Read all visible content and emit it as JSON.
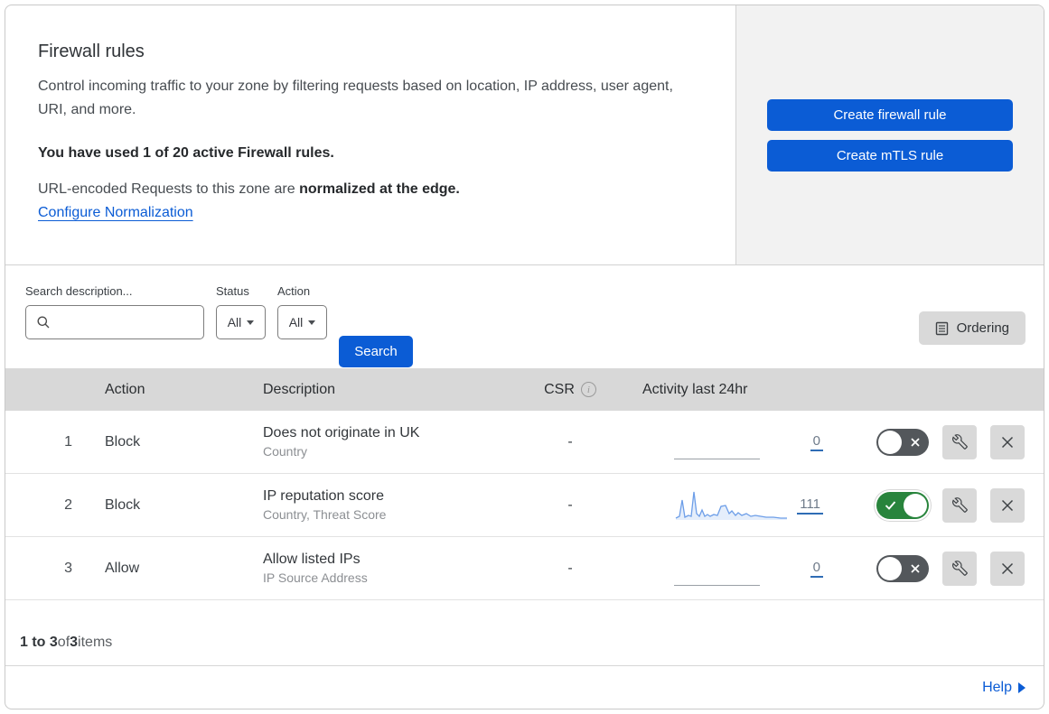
{
  "header": {
    "title": "Firewall rules",
    "description": "Control incoming traffic to your zone by filtering requests based on location, IP address, user agent, URI, and more.",
    "usage_line": "You have used 1 of 20 active Firewall rules.",
    "normalization_prefix": "URL-encoded Requests to this zone are ",
    "normalization_bold": "normalized at the edge.",
    "configure_link": "Configure Normalization",
    "buttons": [
      {
        "label": "Create firewall rule"
      },
      {
        "label": "Create mTLS rule"
      }
    ]
  },
  "filters": {
    "search_label": "Search description...",
    "status_label": "Status",
    "status_value": "All",
    "action_label": "Action",
    "action_value": "All",
    "search_button": "Search",
    "ordering_button": "Ordering"
  },
  "table": {
    "columns": {
      "action": "Action",
      "description": "Description",
      "csr": "CSR",
      "activity": "Activity last 24hr"
    },
    "rows": [
      {
        "num": "1",
        "action": "Block",
        "description": "Does not originate in UK",
        "criteria": "Country",
        "csr": "-",
        "activity_count": "0",
        "enabled": false
      },
      {
        "num": "2",
        "action": "Block",
        "description": "IP reputation score",
        "criteria": "Country, Threat Score",
        "csr": "-",
        "activity_count": "111",
        "enabled": true,
        "sparkline_points": [
          [
            2,
            33
          ],
          [
            6,
            31
          ],
          [
            9,
            13
          ],
          [
            12,
            32
          ],
          [
            16,
            30
          ],
          [
            19,
            31
          ],
          [
            22,
            4
          ],
          [
            25,
            28
          ],
          [
            28,
            31
          ],
          [
            31,
            24
          ],
          [
            34,
            31
          ],
          [
            37,
            29
          ],
          [
            40,
            31
          ],
          [
            44,
            29
          ],
          [
            48,
            30
          ],
          [
            52,
            20
          ],
          [
            57,
            19
          ],
          [
            61,
            28
          ],
          [
            64,
            25
          ],
          [
            68,
            30
          ],
          [
            71,
            27
          ],
          [
            75,
            30
          ],
          [
            80,
            28
          ],
          [
            85,
            31
          ],
          [
            90,
            30
          ],
          [
            96,
            31
          ],
          [
            102,
            32
          ],
          [
            110,
            32
          ],
          [
            118,
            33
          ],
          [
            125,
            33
          ]
        ]
      },
      {
        "num": "3",
        "action": "Allow",
        "description": "Allow listed IPs",
        "criteria": "IP Source Address",
        "csr": "-",
        "activity_count": "0",
        "enabled": false
      }
    ]
  },
  "pagination": {
    "range": "1 to 3",
    "of": " of ",
    "total": "3",
    "items": " items"
  },
  "help": {
    "label": "Help"
  },
  "icons": {
    "search": "magnifier",
    "ordering": "document-list",
    "info": "circle-i",
    "info_glyph": "i",
    "caret": "triangle-down",
    "wrench": "spanner",
    "close": "x-mark",
    "toggle_on_mark": "check-mark",
    "toggle_off_mark": "x-mark",
    "help_arrow": "triangle-right"
  },
  "colors": {
    "accent_blue": "#0b5cd5",
    "link_blue": "#0b5cd5",
    "toggle_on_green": "#28843c",
    "toggle_off_gray": "#53575b",
    "panel_gray": "#f2f2f2",
    "table_header_gray": "#d8d8d8",
    "control_gray": "#d9d9d9",
    "sparkline_blue": "#6d9ee8"
  }
}
